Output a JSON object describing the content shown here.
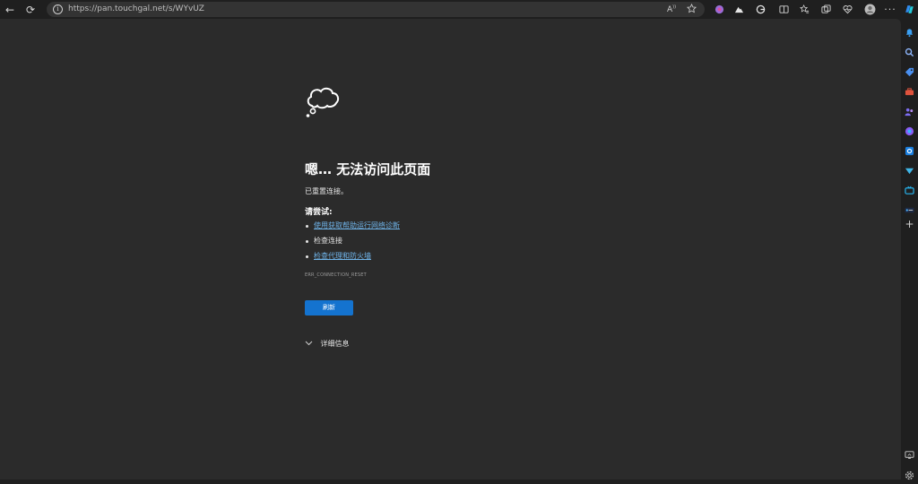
{
  "toolbar": {
    "back_icon": "←",
    "refresh_icon": "⟳",
    "url": "https://pan.touchgal.net/s/WYvUZ",
    "read_aloud_label": "A"
  },
  "page": {
    "headline": "嗯… 无法访问此页面",
    "subline": "已重置连接。",
    "try_label": "请尝试:",
    "suggestions": [
      {
        "text": "使用获取帮助运行网络诊断",
        "link": true
      },
      {
        "text": "检查连接",
        "link": false
      },
      {
        "text": "检查代理和防火墙",
        "link": true
      }
    ],
    "error_code": "ERR_CONNECTION_RESET",
    "refresh_label": "刷新",
    "details_label": "详细信息"
  },
  "colors": {
    "accent": "#1473cf",
    "link": "#6fb3e8",
    "page_bg": "#2b2b2b",
    "chrome_bg": "#1f1f1f"
  }
}
